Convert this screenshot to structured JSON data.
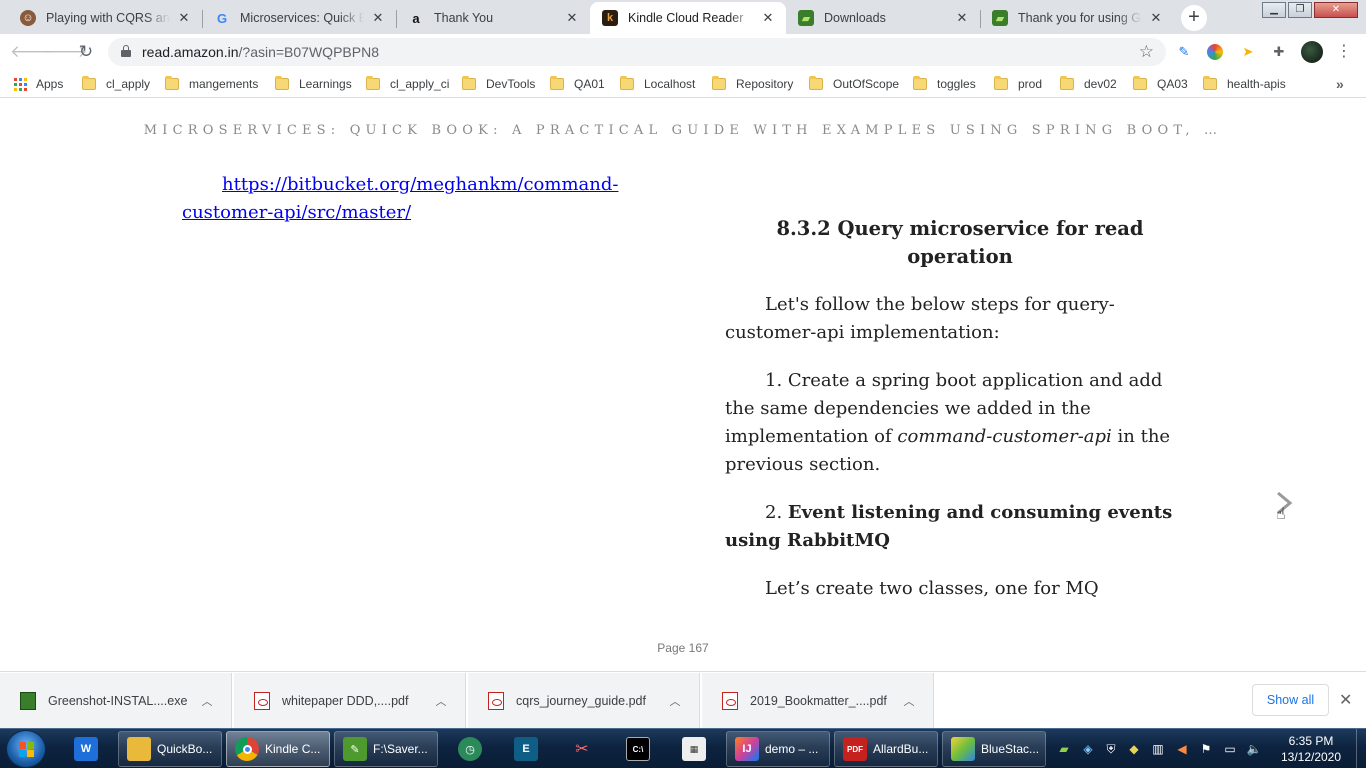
{
  "tabs": [
    {
      "title": "Playing with CQRS and E",
      "icon": "avatar-favicon",
      "color": "#8a5a3c"
    },
    {
      "title": "Microservices: Quick Boo",
      "icon": "google-favicon",
      "color": "#4285f4"
    },
    {
      "title": "Thank You",
      "icon": "amazon-favicon",
      "color": "#ff9900"
    },
    {
      "title": "Kindle Cloud Reader",
      "icon": "kindle-favicon",
      "color": "#c26d2e"
    },
    {
      "title": "Downloads",
      "icon": "greenshot-favicon",
      "color": "#3a7d2a"
    },
    {
      "title": "Thank you for using Gre",
      "icon": "greenshot-favicon",
      "color": "#3a7d2a"
    }
  ],
  "toolbar": {
    "url_host": "read.amazon.in",
    "url_path": "/?asin=B07WQPBPN8"
  },
  "bookmarks": [
    "Apps",
    "cl_apply",
    "mangements",
    "Learnings",
    "cl_apply_ci",
    "DevTools",
    "QA01",
    "Localhost",
    "Repository",
    "OutOfScope",
    "toggles",
    "prod",
    "dev02",
    "QA03",
    "health-apis"
  ],
  "book": {
    "running_title": "MICROSERVICES: QUICK BOOK: A PRACTICAL GUIDE WITH EXAMPLES USING SPRING BOOT, …",
    "link": "https://bitbucket.org/meghankm/command-customer-api/src/master/",
    "heading": "8.3.2 Query microservice for read operation",
    "para1": "Let's follow the below steps for query-customer-api implementation:",
    "step1_pre": "1. Create a spring boot application and add the same dependencies we added in the implementation of ",
    "step1_em": "command-customer-api",
    "step1_post": " in the previous section.",
    "step2_num": "2. ",
    "step2_bold": "Event listening and consuming events using RabbitMQ",
    "para3": "Let’s create two classes, one for MQ",
    "page_label": "Page 167"
  },
  "downloads": [
    {
      "name": "Greenshot-INSTAL....exe",
      "type": "exe"
    },
    {
      "name": "whitepaper DDD,....pdf",
      "type": "pdf"
    },
    {
      "name": "cqrs_journey_guide.pdf",
      "type": "pdf"
    },
    {
      "name": "2019_Bookmatter_....pdf",
      "type": "pdf"
    }
  ],
  "shelf": {
    "show_all": "Show all"
  },
  "taskbar": {
    "items": [
      {
        "label": "QuickBo...",
        "icon": "folder-icon",
        "color": "#e8b93a"
      },
      {
        "label": "Kindle C...",
        "icon": "chrome-icon",
        "color": "#db4437"
      },
      {
        "label": "F:\\Saver...",
        "icon": "notepad-icon",
        "color": "#4e9a2f"
      },
      {
        "label": "demo – ...",
        "icon": "intellij-icon",
        "color": "#d13f9b"
      },
      {
        "label": "AllardBu...",
        "icon": "pdf-reader-icon",
        "color": "#c5221f"
      },
      {
        "label": "BlueStac...",
        "icon": "bluestacks-icon",
        "color": "#6fbf3c"
      }
    ],
    "time": "6:35 PM",
    "date": "13/12/2020"
  }
}
